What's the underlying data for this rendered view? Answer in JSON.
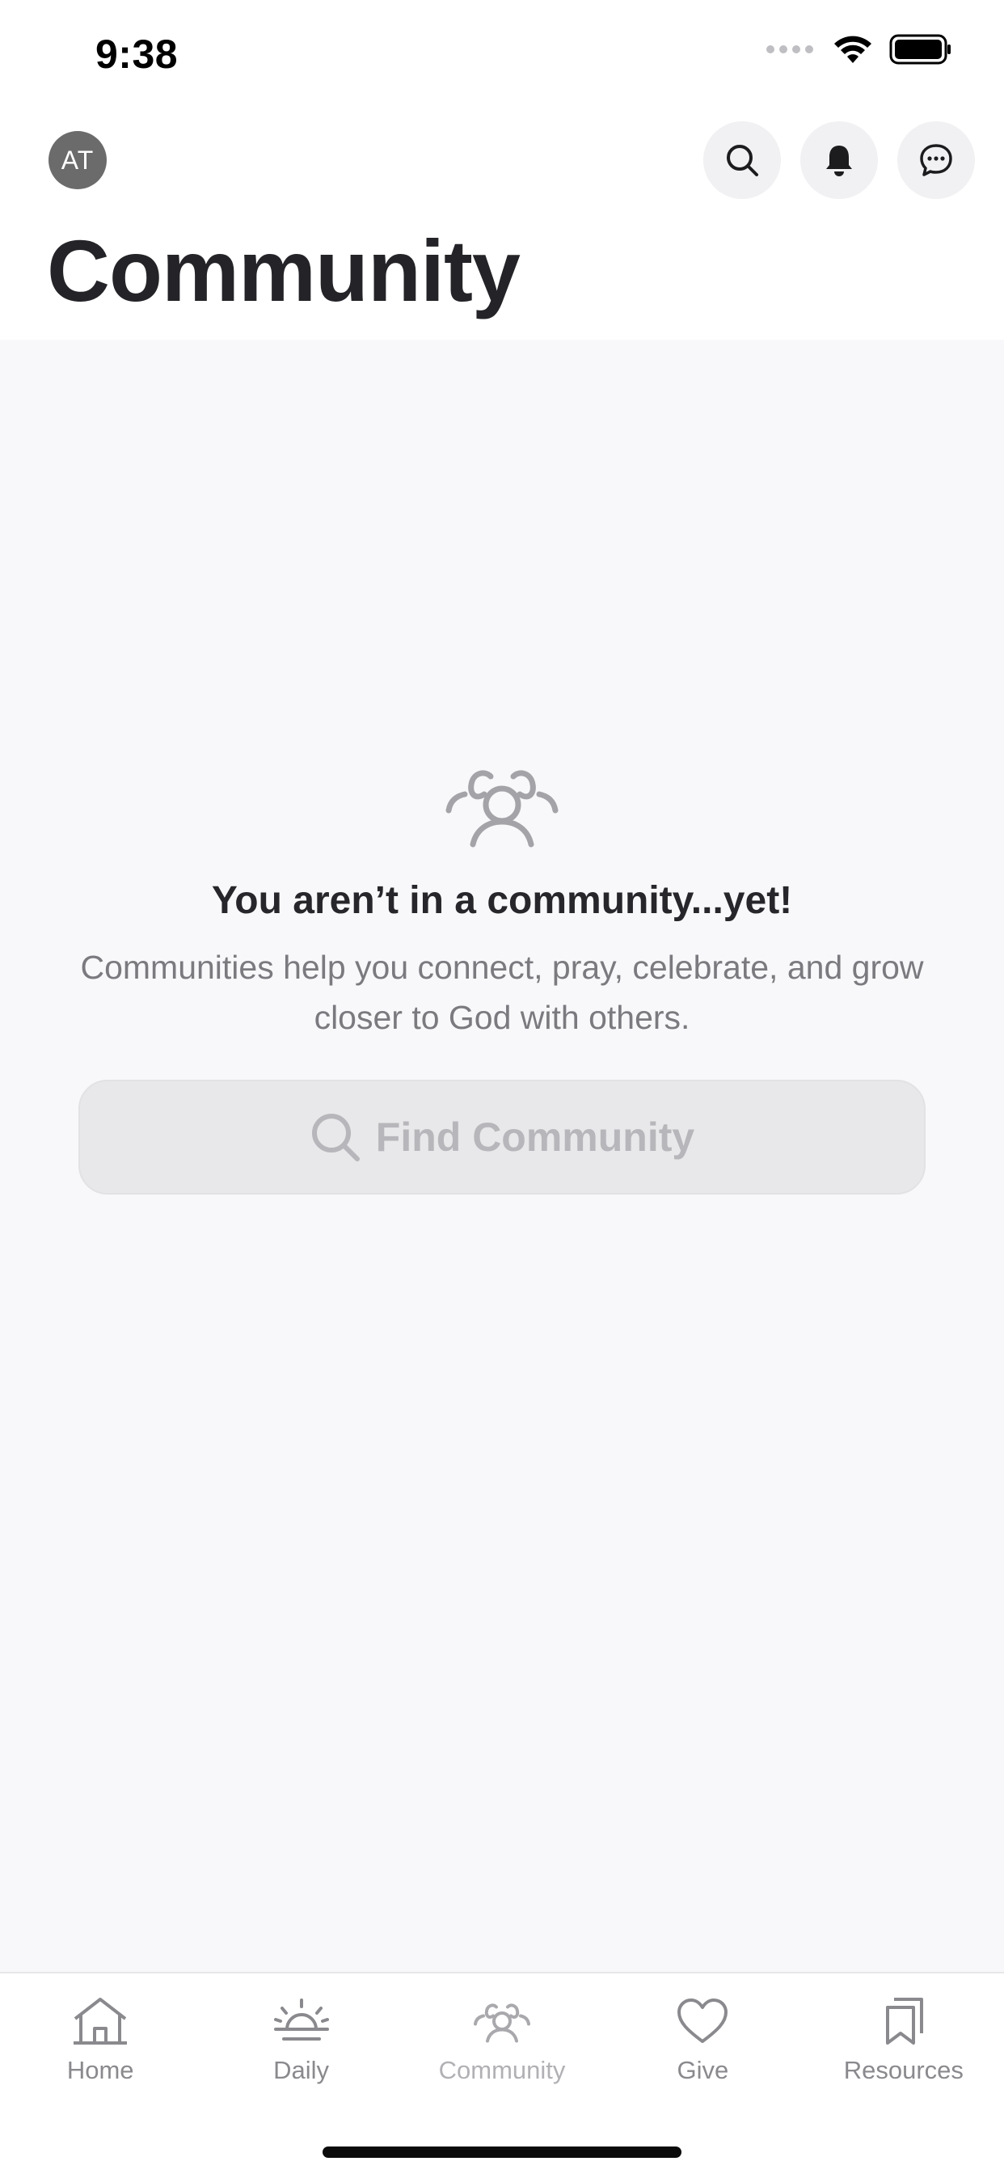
{
  "status_bar": {
    "time": "9:38"
  },
  "header": {
    "avatar_initials": "AT",
    "title": "Community",
    "actions": [
      {
        "name": "search",
        "icon": "search-icon"
      },
      {
        "name": "notifications",
        "icon": "bell-icon"
      },
      {
        "name": "messages",
        "icon": "chat-bubble-icon"
      }
    ]
  },
  "empty_state": {
    "icon": "people-group-icon",
    "heading": "You aren’t in a community...yet!",
    "description": "Communities help you connect, pray, celebrate, and grow closer to God with others.",
    "button_label": "Find Community"
  },
  "tab_bar": {
    "active": "Community",
    "tabs": [
      {
        "label": "Home",
        "icon": "home-icon"
      },
      {
        "label": "Daily",
        "icon": "sunrise-icon"
      },
      {
        "label": "Community",
        "icon": "people-group-icon"
      },
      {
        "label": "Give",
        "icon": "heart-icon"
      },
      {
        "label": "Resources",
        "icon": "bookmarks-icon"
      }
    ]
  },
  "colors": {
    "background_main": "#f8f8fa",
    "title_text": "#242428",
    "muted_text": "#7a7a7f",
    "button_bg": "#e8e8ea",
    "button_text": "#b7b7bb",
    "avatar_bg": "#6b6b6b"
  }
}
